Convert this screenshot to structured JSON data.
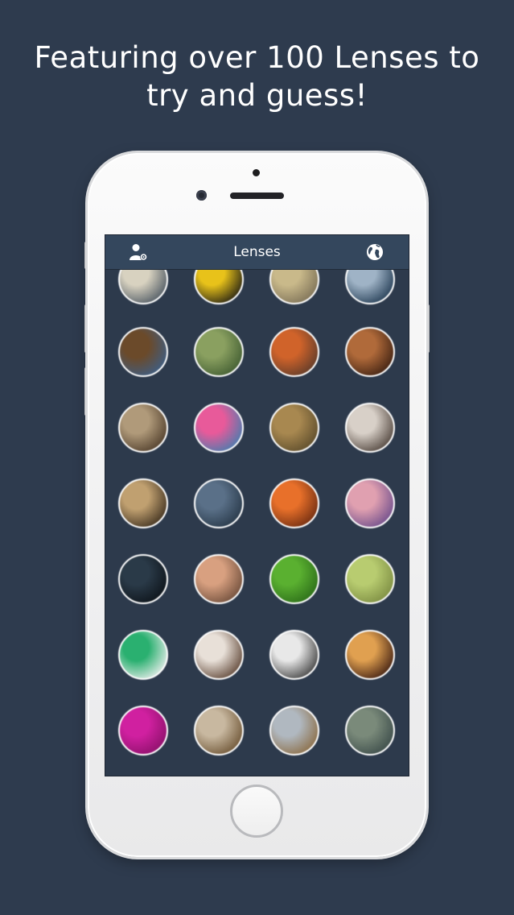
{
  "headline": {
    "line1": "Featuring over 100 Lenses to",
    "line2": "try and guess!"
  },
  "navbar": {
    "title": "Lenses",
    "left_icon": "user-settings-icon",
    "right_icon": "globe-icon"
  },
  "colors": {
    "background": "#2e3b4e",
    "navbar": "#34475d",
    "screen": "#2d3a4c",
    "lens_border": "#ffffff"
  },
  "lenses": [
    {
      "c1": "#d8d2c0",
      "c2": "#4a5560"
    },
    {
      "c1": "#e8c21a",
      "c2": "#1c1a14"
    },
    {
      "c1": "#c9b98a",
      "c2": "#7a6e55"
    },
    {
      "c1": "#9fb3c6",
      "c2": "#1f3850"
    },
    {
      "c1": "#6b4a2a",
      "c2": "#3b5f8a"
    },
    {
      "c1": "#8aa060",
      "c2": "#3e5a30"
    },
    {
      "c1": "#d0632a",
      "c2": "#5a3a2a"
    },
    {
      "c1": "#b06a3a",
      "c2": "#3a1e10"
    },
    {
      "c1": "#b09a7a",
      "c2": "#4c3a28"
    },
    {
      "c1": "#e85a9a",
      "c2": "#3e7fb0"
    },
    {
      "c1": "#a88850",
      "c2": "#5a4a2a"
    },
    {
      "c1": "#d8d0c8",
      "c2": "#4a3e36"
    },
    {
      "c1": "#c0a070",
      "c2": "#3a2c1c"
    },
    {
      "c1": "#5a7088",
      "c2": "#263646"
    },
    {
      "c1": "#e8702a",
      "c2": "#6a2a10"
    },
    {
      "c1": "#e0a0b0",
      "c2": "#6a4a8a"
    },
    {
      "c1": "#2a3a48",
      "c2": "#0c1218"
    },
    {
      "c1": "#d8a080",
      "c2": "#6a4a38"
    },
    {
      "c1": "#5ab030",
      "c2": "#2a6a18"
    },
    {
      "c1": "#b8cc70",
      "c2": "#7a8a40"
    },
    {
      "c1": "#2ab070",
      "c2": "#f0f0f0"
    },
    {
      "c1": "#e8e0d8",
      "c2": "#5a4030"
    },
    {
      "c1": "#e8e8e8",
      "c2": "#3a3a3a"
    },
    {
      "c1": "#e0a050",
      "c2": "#3a1a10"
    },
    {
      "c1": "#d020a0",
      "c2": "#8a1068"
    },
    {
      "c1": "#c8b8a0",
      "c2": "#6a5030"
    },
    {
      "c1": "#b0b8c0",
      "c2": "#8a6a40"
    },
    {
      "c1": "#7a8a7a",
      "c2": "#3a4a48"
    }
  ]
}
